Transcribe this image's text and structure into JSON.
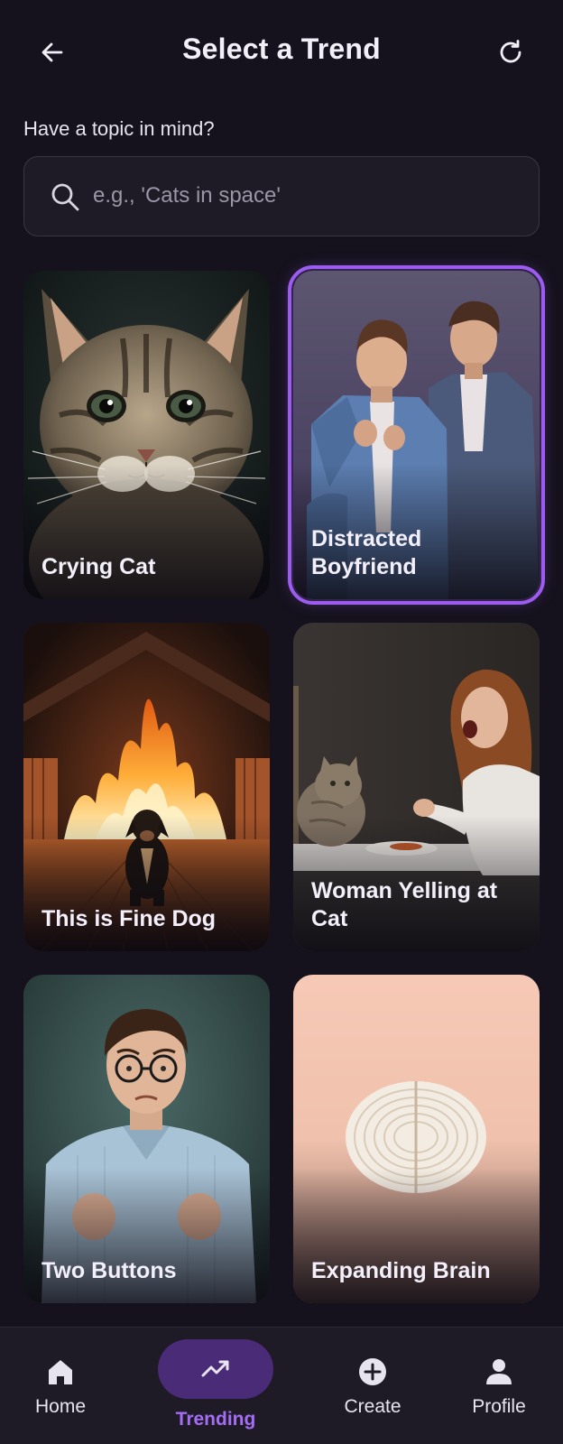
{
  "header": {
    "title": "Select a Trend",
    "back_icon": "arrow-left-icon",
    "refresh_icon": "refresh-icon"
  },
  "search": {
    "label": "Have a topic in mind?",
    "placeholder": "e.g., 'Cats in space'",
    "value": "",
    "icon": "search-icon"
  },
  "trends": [
    {
      "label": "Crying Cat",
      "selected": false
    },
    {
      "label": "Distracted Boyfriend",
      "selected": true
    },
    {
      "label": "This is Fine Dog",
      "selected": false
    },
    {
      "label": "Woman Yelling at Cat",
      "selected": false
    },
    {
      "label": "Two Buttons",
      "selected": false
    },
    {
      "label": "Expanding Brain",
      "selected": false
    }
  ],
  "nav": {
    "items": [
      {
        "label": "Home",
        "icon": "home-icon",
        "active": false
      },
      {
        "label": "Trending",
        "icon": "trending-icon",
        "active": true
      },
      {
        "label": "Create",
        "icon": "plus-circle-icon",
        "active": false
      },
      {
        "label": "Profile",
        "icon": "person-icon",
        "active": false
      }
    ]
  },
  "colors": {
    "background": "#15121d",
    "accent": "#9d5cf0",
    "active_pill": "#4a2b78",
    "active_label": "#a56df5"
  }
}
